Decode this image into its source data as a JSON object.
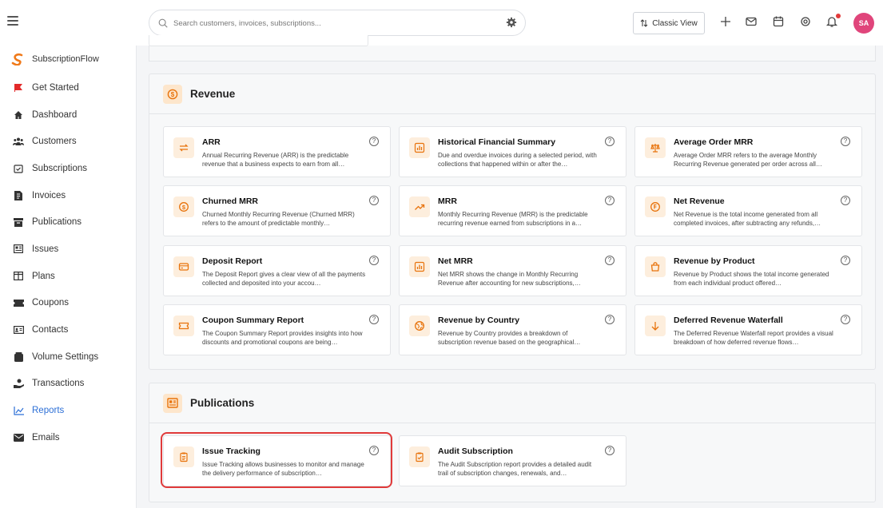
{
  "topbar": {
    "search_placeholder": "Search customers, invoices, subscriptions...",
    "classic_view_label": "Classic View",
    "avatar_initials": "SA"
  },
  "sidebar": {
    "brand": "SubscriptionFlow",
    "items": [
      {
        "label": "Get Started",
        "icon": "flag-icon"
      },
      {
        "label": "Dashboard",
        "icon": "home-icon"
      },
      {
        "label": "Customers",
        "icon": "users-icon"
      },
      {
        "label": "Subscriptions",
        "icon": "calendar-check-icon"
      },
      {
        "label": "Invoices",
        "icon": "invoice-icon"
      },
      {
        "label": "Publications",
        "icon": "archive-icon"
      },
      {
        "label": "Issues",
        "icon": "newspaper-icon"
      },
      {
        "label": "Plans",
        "icon": "columns-icon"
      },
      {
        "label": "Coupons",
        "icon": "ticket-icon"
      },
      {
        "label": "Contacts",
        "icon": "contact-card-icon"
      },
      {
        "label": "Volume Settings",
        "icon": "box-icon"
      },
      {
        "label": "Transactions",
        "icon": "hand-money-icon"
      },
      {
        "label": "Reports",
        "icon": "chart-line-icon"
      },
      {
        "label": "Emails",
        "icon": "mail-icon"
      }
    ],
    "active": "Reports"
  },
  "revenue": {
    "title": "Revenue",
    "cards": [
      {
        "title": "ARR",
        "desc": "Annual Recurring Revenue (ARR) is the predictable revenue that a business expects to earn from all…",
        "icon": "arrows-exchange-icon"
      },
      {
        "title": "Historical Financial Summary",
        "desc": "Due and overdue invoices during a selected period, with collections that happened within or after the…",
        "icon": "bar-chart-icon"
      },
      {
        "title": "Average Order MRR",
        "desc": "Average Order MRR refers to the average Monthly Recurring Revenue generated per order across all…",
        "icon": "scale-icon"
      },
      {
        "title": "Churned MRR",
        "desc": "Churned Monthly Recurring Revenue (Churned MRR) refers to the amount of predictable monthly…",
        "icon": "dollar-coin-icon"
      },
      {
        "title": "MRR",
        "desc": "Monthly Recurring Revenue (MRR) is the predictable recurring revenue earned from subscriptions in a…",
        "icon": "trending-up-icon"
      },
      {
        "title": "Net Revenue",
        "desc": "Net Revenue is the total income generated from all completed invoices, after subtracting any refunds,…",
        "icon": "coin-icon"
      },
      {
        "title": "Deposit Report",
        "desc": "The Deposit Report gives a clear view of all the payments collected and deposited into your accou…",
        "icon": "credit-card-icon"
      },
      {
        "title": "Net MRR",
        "desc": "Net MRR shows the change in Monthly Recurring Revenue after accounting for new subscriptions,…",
        "icon": "bar-chart-icon"
      },
      {
        "title": "Revenue by Product",
        "desc": "Revenue by Product shows the total income generated from each individual product offered…",
        "icon": "shopping-bag-icon"
      },
      {
        "title": "Coupon Summary Report",
        "desc": "The Coupon Summary Report provides insights into how discounts and promotional coupons are being…",
        "icon": "ticket-icon"
      },
      {
        "title": "Revenue by Country",
        "desc": "Revenue by Country provides a breakdown of subscription revenue based on the geographical…",
        "icon": "globe-icon"
      },
      {
        "title": "Deferred Revenue Waterfall",
        "desc": "The Deferred Revenue Waterfall report provides a visual breakdown of how deferred revenue flows…",
        "icon": "arrow-down-icon"
      }
    ]
  },
  "publications": {
    "title": "Publications",
    "cards": [
      {
        "title": "Issue Tracking",
        "desc": "Issue Tracking allows businesses to monitor and manage the delivery performance of subscription…",
        "icon": "clipboard-icon"
      },
      {
        "title": "Audit Subscription",
        "desc": "The Audit Subscription report provides a detailed audit trail of subscription changes, renewals, and…",
        "icon": "clipboard-check-icon"
      }
    ]
  },
  "help_glyph": "?",
  "colors": {
    "accent": "#e8730c",
    "active_nav": "#2c6fd6",
    "highlight": "#e03a3a",
    "avatar": "#e0457b"
  }
}
